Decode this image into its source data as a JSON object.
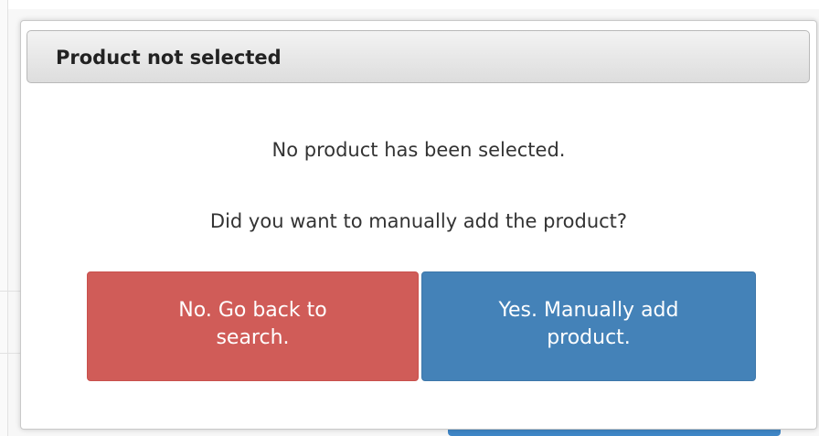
{
  "dialog": {
    "title": "Product not selected",
    "message_1": "No product has been selected.",
    "message_2": "Did you want to manually add the product?",
    "buttons": {
      "no_label": "No. Go back to search.",
      "yes_label": "Yes. Manually add product."
    }
  },
  "colors": {
    "no_button": "#d05c58",
    "yes_button": "#4482b8",
    "header_gradient_top": "#f3f3f3",
    "header_gradient_bottom": "#dddddd"
  }
}
